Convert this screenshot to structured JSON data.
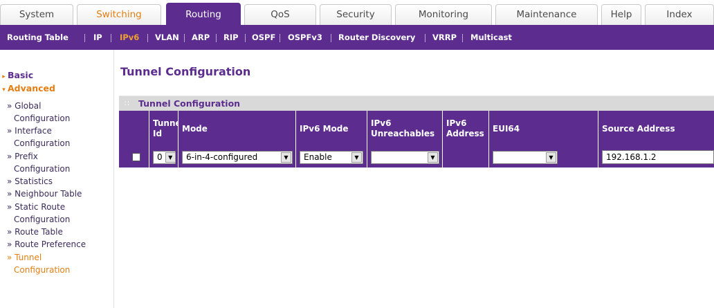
{
  "top_tabs": [
    {
      "label": "System"
    },
    {
      "label": "Switching"
    },
    {
      "label": "Routing"
    },
    {
      "label": "QoS"
    },
    {
      "label": "Security"
    },
    {
      "label": "Monitoring"
    },
    {
      "label": "Maintenance"
    },
    {
      "label": "Help"
    },
    {
      "label": "Index"
    }
  ],
  "subnav": [
    {
      "label": "Routing Table"
    },
    {
      "label": "IP"
    },
    {
      "label": "IPv6"
    },
    {
      "label": "VLAN"
    },
    {
      "label": "ARP"
    },
    {
      "label": "RIP"
    },
    {
      "label": "OSPF"
    },
    {
      "label": "OSPFv3"
    },
    {
      "label": "Router Discovery"
    },
    {
      "label": "VRRP"
    },
    {
      "label": "Multicast"
    }
  ],
  "sidebar": {
    "basic": "Basic",
    "advanced": "Advanced",
    "items": [
      {
        "l1": "» Global",
        "l2": "Configuration"
      },
      {
        "l1": "» Interface",
        "l2": "Configuration"
      },
      {
        "l1": "» Prefix",
        "l2": "Configuration"
      },
      {
        "l1": "» Statistics"
      },
      {
        "l1": "» Neighbour Table"
      },
      {
        "l1": "» Static Route",
        "l2": "Configuration"
      },
      {
        "l1": "» Route Table"
      },
      {
        "l1": "» Route Preference"
      },
      {
        "l1": "» Tunnel",
        "l2": "Configuration"
      }
    ]
  },
  "page": {
    "title": "Tunnel Configuration",
    "panel_title": "Tunnel Configuration"
  },
  "table": {
    "headers": [
      {
        "line1": "",
        "line2": ""
      },
      {
        "line1": "Tunnel",
        "line2": "Id"
      },
      {
        "line1": "Mode",
        "line2": ""
      },
      {
        "line1": "IPv6 Mode",
        "line2": ""
      },
      {
        "line1": "IPv6",
        "line2": "Unreachables"
      },
      {
        "line1": "IPv6",
        "line2": "Address"
      },
      {
        "line1": "EUI64",
        "line2": ""
      },
      {
        "line1": "Source Address",
        "line2": ""
      }
    ],
    "row": {
      "tunnel_id": "0",
      "mode": "6-in-4-configured",
      "ipv6_mode": "Enable",
      "ipv6_unreachables": "",
      "eui64": "",
      "source_address": "192.168.1.2"
    }
  },
  "colors": {
    "brand_purple": "#5c2d8e",
    "accent_orange": "#e47e13"
  }
}
